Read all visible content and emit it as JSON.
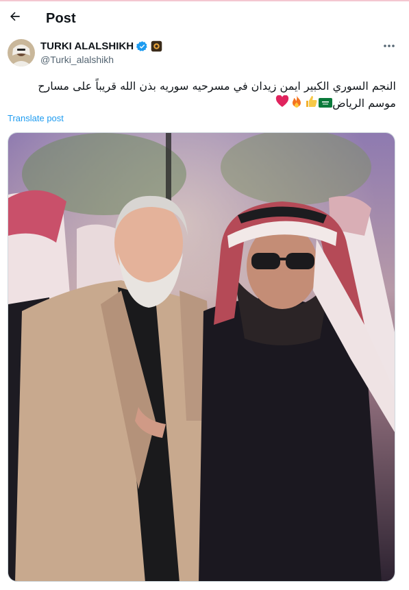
{
  "header": {
    "title": "Post"
  },
  "post": {
    "author_name": "TURKI ALALSHIKH",
    "author_handle": "@Turki_alalshikh",
    "text": "النجم السوري الكبير ايمن زيدان في مسرحيه سوريه بذن الله قريباً على مسارح موسم الرياض",
    "emojis": [
      "saudi-flag",
      "thumbs-up",
      "fire",
      "red-heart"
    ],
    "translate_label": "Translate post"
  },
  "icons": {
    "back": "left-arrow-icon",
    "verified": "verified-badge-icon",
    "affiliation": "affiliation-badge-icon",
    "more": "more-dots-icon"
  },
  "colors": {
    "accent": "#1d9bf0",
    "secondary_text": "#536471",
    "primary_text": "#0f1419"
  }
}
